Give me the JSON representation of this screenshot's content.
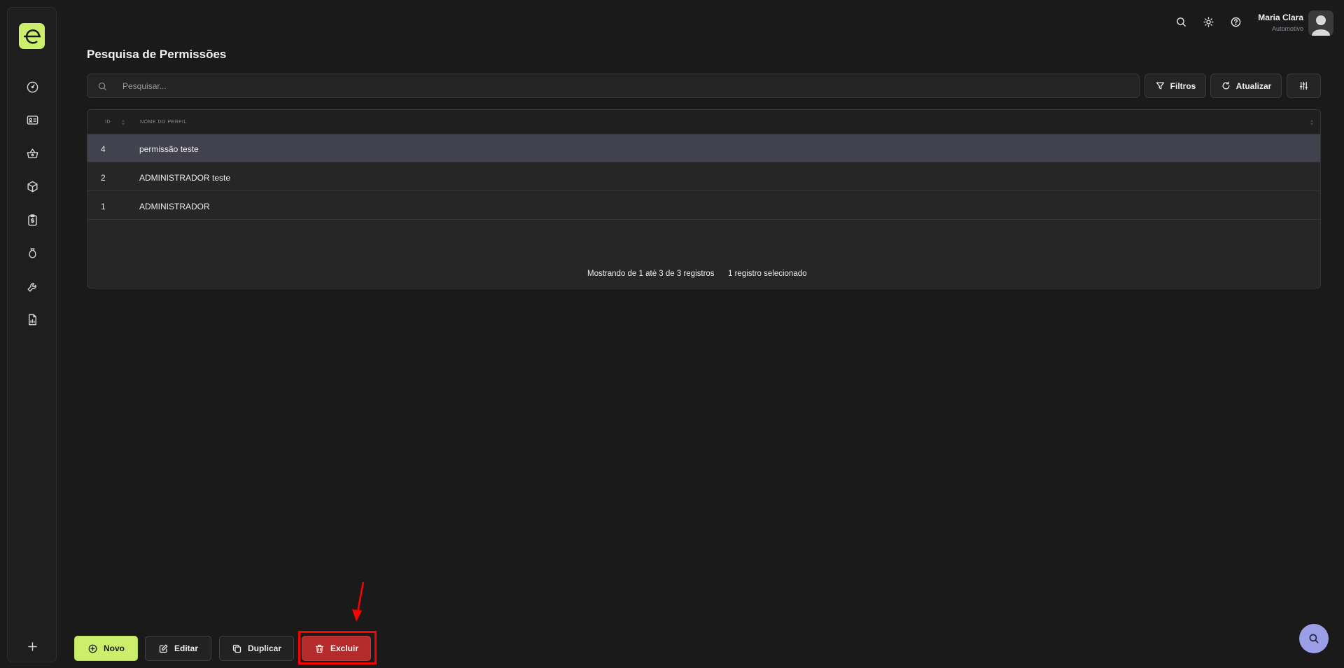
{
  "header": {
    "page_title": "Pesquisa de Permissões",
    "user_name": "Maria Clara",
    "user_subtitle": "Automotivo"
  },
  "toolbar": {
    "search_placeholder": "Pesquisar...",
    "filters_label": "Filtros",
    "refresh_label": "Atualizar"
  },
  "table": {
    "columns": [
      "ID",
      "NOME DO PERFIL"
    ],
    "rows": [
      {
        "id": "4",
        "name": "permissão teste",
        "selected": true
      },
      {
        "id": "2",
        "name": "ADMINISTRADOR teste",
        "selected": false
      },
      {
        "id": "1",
        "name": "ADMINISTRADOR",
        "selected": false
      }
    ],
    "footer_showing": "Mostrando de 1 até 3 de 3 registros",
    "footer_selected": "1 registro selecionado"
  },
  "actions": {
    "new_label": "Novo",
    "edit_label": "Editar",
    "duplicate_label": "Duplicar",
    "delete_label": "Excluir"
  },
  "sidebar": {
    "items": [
      {
        "icon": "dashboard-gauge-icon"
      },
      {
        "icon": "id-card-icon"
      },
      {
        "icon": "basket-icon"
      },
      {
        "icon": "package-box-icon"
      },
      {
        "icon": "clipboard-dollar-icon"
      },
      {
        "icon": "money-bag-icon"
      },
      {
        "icon": "wrench-icon"
      },
      {
        "icon": "report-chart-icon"
      }
    ]
  },
  "colors": {
    "accent": "#cbef6b",
    "danger": "#b52b2b",
    "fab": "#9a9ee6",
    "selected_row": "#42414e"
  }
}
